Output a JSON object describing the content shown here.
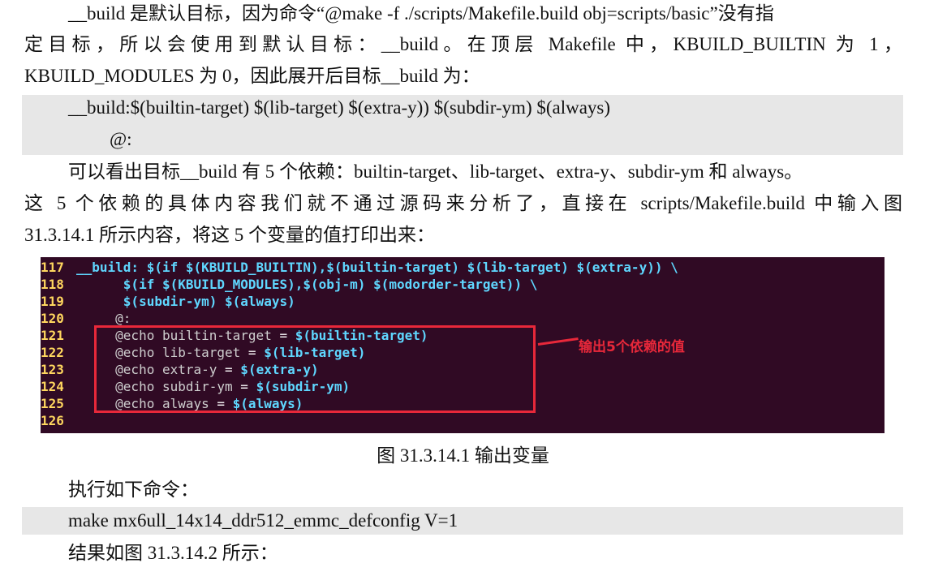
{
  "paragraph1": {
    "line1": "__build 是默认目标，因为命令“@make -f ./scripts/Makefile.build obj=scripts/basic”没有指",
    "line2": "定目标，所以会使用到默认目标：__build。在顶层 Makefile 中，KBUILD_BUILTIN 为 1，",
    "line3": "KBUILD_MODULES 为 0，因此展开后目标__build 为："
  },
  "code_block1": {
    "line1": "__build:$(builtin-target) $(lib-target) $(extra-y)) $(subdir-ym) $(always)",
    "line2": "@:"
  },
  "paragraph2": {
    "line1": "可以看出目标__build 有 5 个依赖：builtin-target、lib-target、extra-y、subdir-ym 和 always。",
    "line2": "这 5 个依赖的具体内容我们就不通过源码来分析了，直接在 scripts/Makefile.build 中输入图",
    "line3": "31.3.14.1 所示内容，将这 5 个变量的值打印出来："
  },
  "terminal": {
    "lines": [
      {
        "num": "117",
        "parts": [
          {
            "cls": "kw",
            "text": "__build: $(if $(KBUILD_BUILTIN),$(builtin-target) $(lib-target) $(extra-y)) \\"
          }
        ]
      },
      {
        "num": "118",
        "parts": [
          {
            "cls": "kw",
            "text": "      $(if $(KBUILD_MODULES),$(obj-m) $(modorder-target)) \\"
          }
        ]
      },
      {
        "num": "119",
        "parts": [
          {
            "cls": "kw",
            "text": "      $(subdir-ym) $(always)"
          }
        ]
      },
      {
        "num": "120",
        "parts": [
          {
            "cls": "plain",
            "text": "     @:"
          }
        ]
      },
      {
        "num": "121",
        "parts": [
          {
            "cls": "plain",
            "text": "     @echo builtin-target "
          },
          {
            "cls": "eq",
            "text": "="
          },
          {
            "cls": "kw",
            "text": " $(builtin-target)"
          }
        ]
      },
      {
        "num": "122",
        "parts": [
          {
            "cls": "plain",
            "text": "     @echo lib-target "
          },
          {
            "cls": "eq",
            "text": "="
          },
          {
            "cls": "kw",
            "text": " $(lib-target)"
          }
        ]
      },
      {
        "num": "123",
        "parts": [
          {
            "cls": "plain",
            "text": "     @echo extra-y "
          },
          {
            "cls": "eq",
            "text": "="
          },
          {
            "cls": "kw",
            "text": " $(extra-y)"
          }
        ]
      },
      {
        "num": "124",
        "parts": [
          {
            "cls": "plain",
            "text": "     @echo subdir-ym "
          },
          {
            "cls": "eq",
            "text": "="
          },
          {
            "cls": "kw",
            "text": " $(subdir-ym)"
          }
        ]
      },
      {
        "num": "125",
        "parts": [
          {
            "cls": "plain",
            "text": "     @echo always "
          },
          {
            "cls": "eq",
            "text": "="
          },
          {
            "cls": "kw",
            "text": " $(always)"
          }
        ]
      },
      {
        "num": "126",
        "parts": []
      }
    ],
    "annotation": "输出5个依赖的值",
    "colors": {
      "background": "#300a24",
      "line_numbers": "#ffd75f",
      "keyword": "#5fd7ff",
      "highlight_box": "#e8283a"
    }
  },
  "figure_caption": "图 31.3.14.1  输出变量",
  "paragraph3": "执行如下命令：",
  "code_block2": "make mx6ull_14x14_ddr512_emmc_defconfig V=1",
  "paragraph4": "结果如图 31.3.14.2 所示："
}
